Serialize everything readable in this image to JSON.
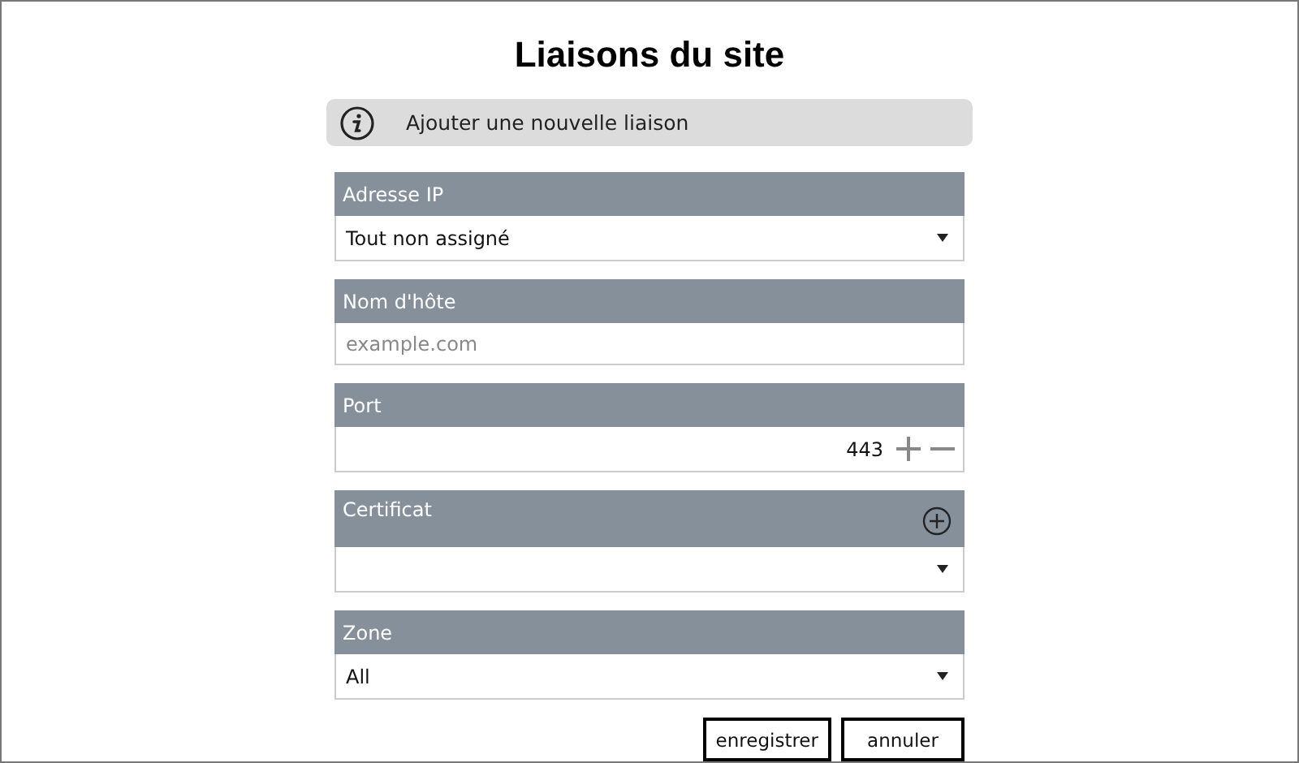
{
  "title": "Liaisons du site",
  "info": {
    "text": "Ajouter une nouvelle liaison"
  },
  "fields": [
    {
      "kind": "dropdown",
      "label": "Adresse IP",
      "value": "Tout non assigné"
    },
    {
      "kind": "text",
      "label": "Nom d'hôte",
      "placeholder": "example.com"
    },
    {
      "kind": "number",
      "label": "Port",
      "value": "443"
    },
    {
      "kind": "dropdown",
      "label": "Certificat",
      "add_button": true
    },
    {
      "kind": "dropdown",
      "label": "Zone",
      "value": "All"
    }
  ],
  "buttons": [
    "enregistrer",
    "annuler"
  ]
}
